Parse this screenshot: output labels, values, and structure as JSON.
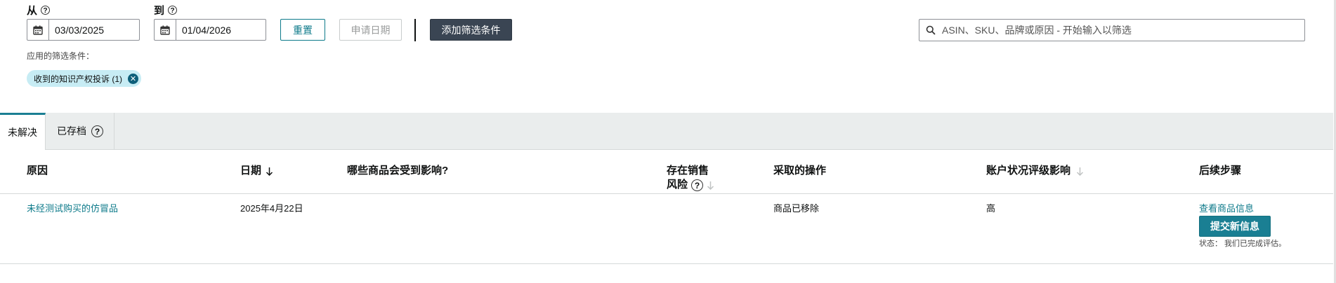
{
  "filters": {
    "from_label": "从",
    "to_label": "到",
    "from_date": "03/03/2025",
    "to_date": "01/04/2026",
    "reset_label": "重置",
    "apply_date_label": "申请日期",
    "add_filter_label": "添加筛选条件",
    "search_placeholder": "ASIN、SKU、品牌或原因 - 开始输入以筛选",
    "applied_label": "应用的筛选条件：",
    "applied_chip": "收到的知识产权投诉 (1)"
  },
  "tabs": [
    {
      "label": "未解决",
      "active": true
    },
    {
      "label": "已存档",
      "active": false
    }
  ],
  "table": {
    "headers": {
      "reason": "原因",
      "date": "日期",
      "affected": "哪些商品会受到影响?",
      "sales_risk_1": "存在销售",
      "sales_risk_2": "风险",
      "action": "采取的操作",
      "health_impact": "账户状况评级影响",
      "next_steps": "后续步骤"
    },
    "rows": [
      {
        "reason": "未经测试购买的仿冒品",
        "date": "2025年4月22日",
        "affected": "",
        "sales_risk": "",
        "action": "商品已移除",
        "health_impact": "高",
        "view_link": "查看商品信息",
        "submit_label": "提交新信息",
        "status_text": "状态： 我们已完成评估。"
      }
    ]
  },
  "colors": {
    "accent": "#1a7f93",
    "dark_button": "#3a4553",
    "chip_bg": "#c7ecf4"
  }
}
